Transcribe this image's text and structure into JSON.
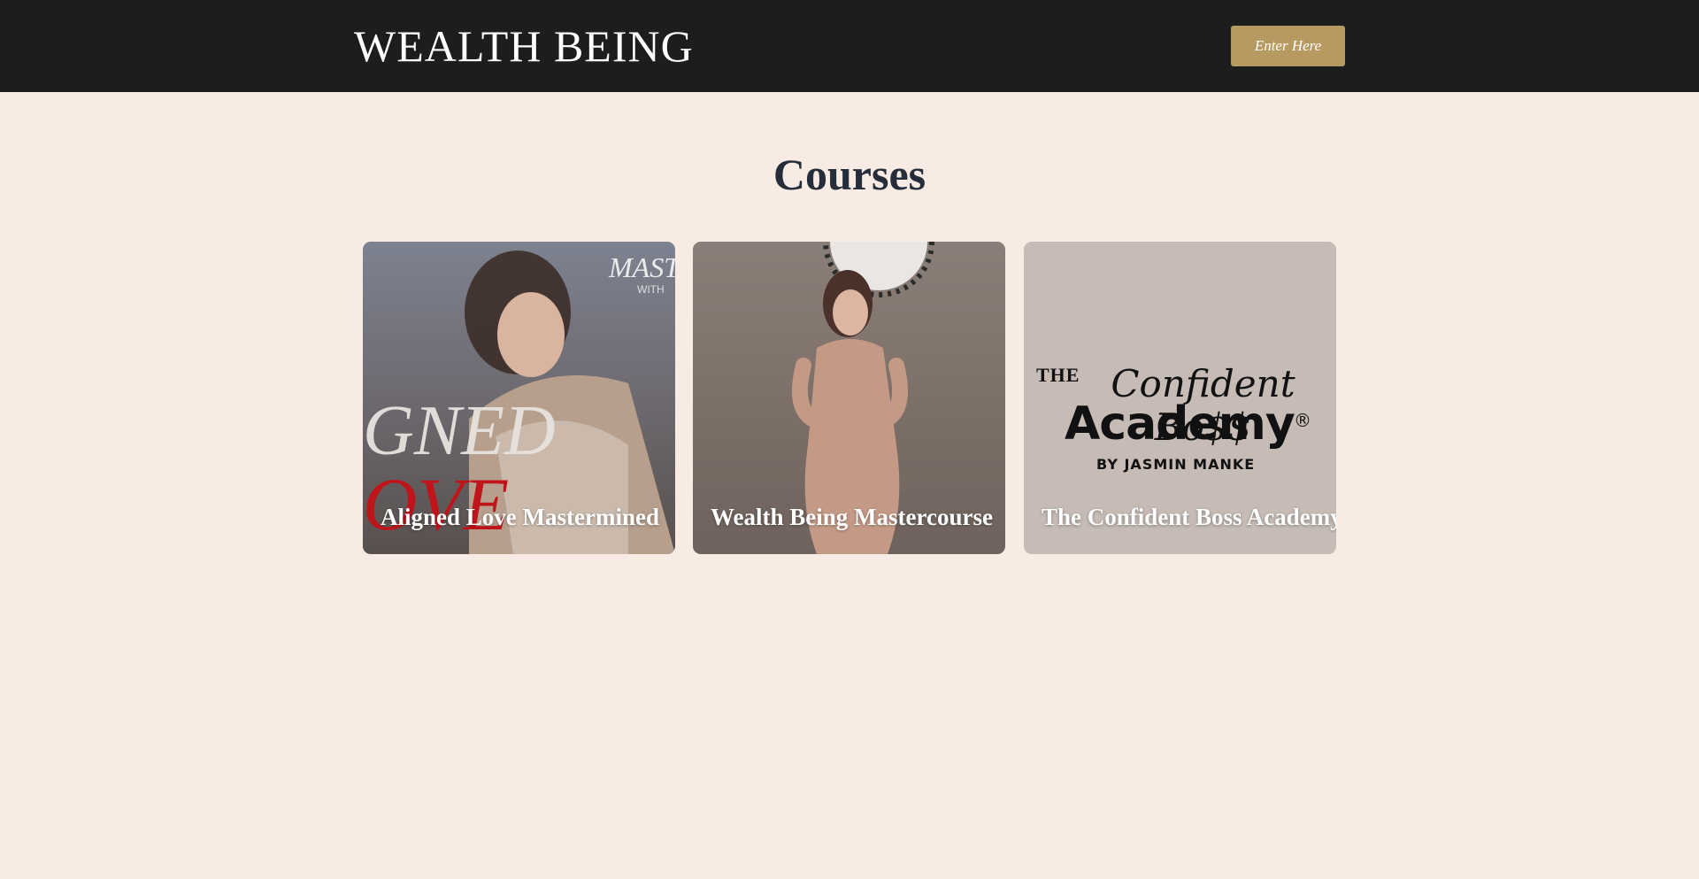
{
  "header": {
    "logo_text": "WEALTH BEING",
    "enter_button_label": "Enter Here"
  },
  "page": {
    "title": "Courses"
  },
  "courses": [
    {
      "title": "Aligned Love Mastermined"
    },
    {
      "title": "Wealth Being Mastercourse"
    },
    {
      "title": "The Confident Boss Academy"
    }
  ],
  "brand_logo": {
    "the": "THE",
    "script": "Confident Bo$$",
    "academy": "Academy",
    "registered": "®",
    "byline": "BY JASMIN MANKE"
  },
  "colors": {
    "header_bg": "#1d1d1d",
    "page_bg": "#f7ebe3",
    "button_bg": "#b79a62",
    "title_color": "#252d3b"
  }
}
